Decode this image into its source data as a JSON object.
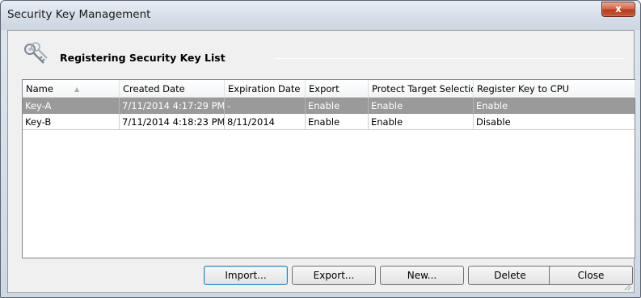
{
  "window": {
    "title": "Security Key Management",
    "close_label": "x"
  },
  "section": {
    "title": "Registering Security Key List",
    "icon": "keys-icon"
  },
  "table": {
    "columns": [
      "Name",
      "Created Date",
      "Expiration Date",
      "Export",
      "Protect Target Selection",
      "Register Key to CPU"
    ],
    "rows": [
      [
        "Key-A",
        "7/11/2014 4:17:29 PM",
        "-",
        "Enable",
        "Enable",
        "Enable"
      ],
      [
        "Key-B",
        "7/11/2014 4:18:23 PM",
        "8/11/2014",
        "Enable",
        "Enable",
        "Disable"
      ]
    ],
    "selected_row": 0,
    "sort_column": "Name"
  },
  "buttons": {
    "import": "Import...",
    "export": "Export...",
    "new": "New...",
    "delete": "Delete",
    "close": "Close"
  },
  "colors": {
    "selected_row": "#9a9a9a",
    "close_button": "#c8583a"
  }
}
